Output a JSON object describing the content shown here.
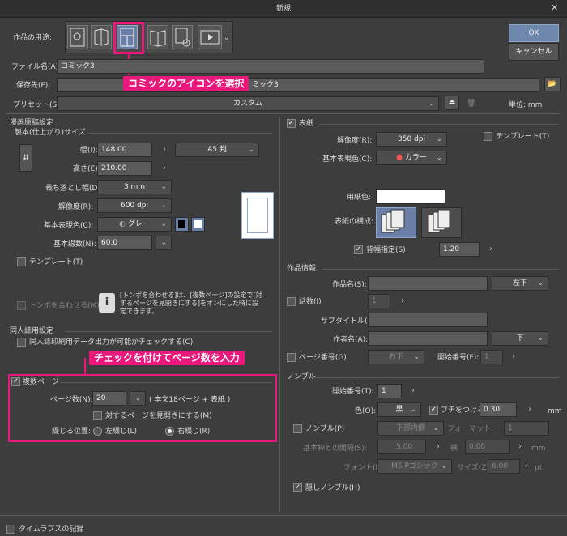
{
  "window": {
    "title": "新規"
  },
  "top": {
    "usage_label": "作品の用途:",
    "ok": "OK",
    "cancel": "キャンセル",
    "filename_label": "ファイル名(A):",
    "filename_value": "コミック3",
    "save_label": "保存先(F):",
    "save_value": "ミック3",
    "preset_label": "プリセット(S):",
    "preset_value": "カスタム",
    "unit_label": "単位: mm"
  },
  "callouts": {
    "c1": "コミックのアイコンを選択",
    "c2": "チェックを付けてページ数を入力"
  },
  "manga": {
    "section": "漫画原稿設定",
    "sub": "製本(仕上がり)サイズ",
    "width_label": "幅(I):",
    "width_value": "148.00",
    "paper_value": "A5 判",
    "height_label": "高さ(E):",
    "height_value": "210.00",
    "bleed_label": "裁ち落とし幅(D):",
    "bleed_value": "3 mm",
    "res_label": "解像度(R):",
    "res_value": "600 dpi",
    "color_label": "基本表現色(C):",
    "color_value": "グレー",
    "lines_label": "基本線数(N):",
    "lines_value": "60.0",
    "template": "テンプレート(T)",
    "tombo_label": "トンボを合わせる(M)",
    "tombo_note": "[トンボを合わせる]は、[複数ページ]の設定で[対するページを見開きにする]をオンにした時に設定できます。"
  },
  "doujin": {
    "section": "同人誌用設定",
    "check": "同人誌印刷用データ出力が可能かチェックする(C)"
  },
  "multi": {
    "label": "複数ページ",
    "pages_label": "ページ数(N):",
    "pages_value": "20",
    "pages_note": "( 本文18ページ + 表紙 )",
    "spread": "対するページを見開きにする(M)",
    "bind_label": "綴じる位置:",
    "left": "左綴じ(L)",
    "right": "右綴じ(R)"
  },
  "cover": {
    "label": "表紙",
    "res_label": "解像度(R):",
    "res_value": "350 dpi",
    "template": "テンプレート(T)",
    "color_label": "基本表現色(C):",
    "color_value": "カラー",
    "paper_label": "用紙色:",
    "compose_label": "表紙の構成:",
    "spine_label": "背幅指定(S)",
    "spine_value": "1.20"
  },
  "info": {
    "section": "作品情報",
    "title_label": "作品名(S):",
    "title_pos": "左下",
    "episode_label": "話数(I)",
    "episode_value": "1",
    "subtitle_label": "サブタイトル(U):",
    "author_label": "作者名(A):",
    "author_pos": "下",
    "pagenum_label": "ページ番号(G)",
    "pagenum_pos": "右下",
    "startnum_label": "開始番号(F):",
    "startnum_value": "1"
  },
  "nombre": {
    "section": "ノンブル",
    "start_label": "開始番号(T):",
    "start_value": "1",
    "color_label": "色(O):",
    "color_value": "黒",
    "border_label": "フチをつける(E)",
    "border_value": "0.30",
    "mm": "mm",
    "hide_label": "ノンブル(P)",
    "pos_value": "下部内側",
    "format_label": "フォーマット:",
    "format_value": "1",
    "gap_label": "基本枠との間隔(S):",
    "gap_value": "5.00",
    "horiz_label": "横",
    "horiz_value": "0.00",
    "font_label": "フォント(F):",
    "font_value": "MS Pゴシック",
    "size_label": "サイズ(Z):",
    "size_value": "6.00",
    "pt": "pt",
    "hidden_label": "隠しノンブル(H)"
  },
  "footer": {
    "timelapse": "タイムラプスの記録"
  }
}
